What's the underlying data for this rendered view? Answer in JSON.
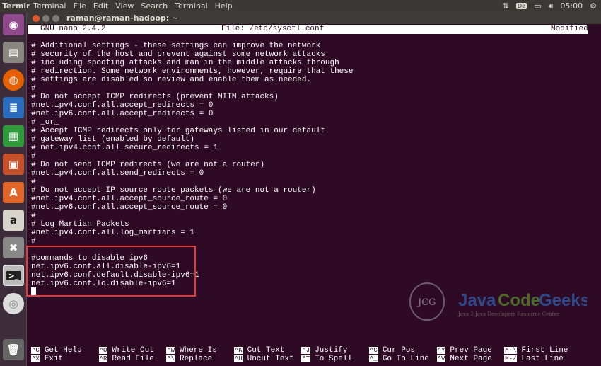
{
  "panel": {
    "app_name": "Terminal",
    "menus": [
      "Terminal",
      "File",
      "Edit",
      "View",
      "Search",
      "Terminal",
      "Help"
    ],
    "keyboard": "De",
    "clock": "05:00"
  },
  "window": {
    "title": "raman@raman-hadoop: ~"
  },
  "nano": {
    "version": "GNU nano 2.4.2",
    "file": "File: /etc/sysctl.conf",
    "status": "Modified"
  },
  "lines": [
    "# Additional settings - these settings can improve the network",
    "# security of the host and prevent against some network attacks",
    "# including spoofing attacks and man in the middle attacks through",
    "# redirection. Some network environments, however, require that these",
    "# settings are disabled so review and enable them as needed.",
    "#",
    "# Do not accept ICMP redirects (prevent MITM attacks)",
    "#net.ipv4.conf.all.accept_redirects = 0",
    "#net.ipv6.conf.all.accept_redirects = 0",
    "# _or_",
    "# Accept ICMP redirects only for gateways listed in our default",
    "# gateway list (enabled by default)",
    "# net.ipv4.conf.all.secure_redirects = 1",
    "#",
    "# Do not send ICMP redirects (we are not a router)",
    "#net.ipv4.conf.all.send_redirects = 0",
    "#",
    "# Do not accept IP source route packets (we are not a router)",
    "#net.ipv4.conf.all.accept_source_route = 0",
    "#net.ipv6.conf.all.accept_source_route = 0",
    "#",
    "# Log Martian Packets",
    "#net.ipv4.conf.all.log_martians = 1",
    "#",
    "",
    "#commands to disable ipv6",
    "net.ipv6.conf.all.disable-ipv6=1",
    "net.ipv6.conf.default.disable-ipv6=1",
    "net.ipv6.conf.lo.disable-ipv6=1"
  ],
  "shortcuts": [
    [
      {
        "key": "^G",
        "label": "Get Help"
      },
      {
        "key": "^X",
        "label": "Exit"
      }
    ],
    [
      {
        "key": "^O",
        "label": "Write Out"
      },
      {
        "key": "^R",
        "label": "Read File"
      }
    ],
    [
      {
        "key": "^W",
        "label": "Where Is"
      },
      {
        "key": "^\\",
        "label": "Replace"
      }
    ],
    [
      {
        "key": "^K",
        "label": "Cut Text"
      },
      {
        "key": "^U",
        "label": "Uncut Text"
      }
    ],
    [
      {
        "key": "^J",
        "label": "Justify"
      },
      {
        "key": "^T",
        "label": "To Spell"
      }
    ],
    [
      {
        "key": "^C",
        "label": "Cur Pos"
      },
      {
        "key": "^_",
        "label": "Go To Line"
      }
    ],
    [
      {
        "key": "^Y",
        "label": "Prev Page"
      },
      {
        "key": "^V",
        "label": "Next Page"
      }
    ],
    [
      {
        "key": "M-\\",
        "label": "First Line"
      },
      {
        "key": "M-/",
        "label": "Last Line"
      }
    ]
  ],
  "watermark": {
    "logo": "JCG",
    "name1": "Java",
    "name2": "Code",
    "name3": "Geeks",
    "tagline": "Java 2 Java Developers Resource Center"
  },
  "launcher": [
    "ubuntu-dash",
    "files",
    "firefox",
    "writer",
    "calc",
    "impress",
    "software-center",
    "amazon",
    "settings",
    "terminal",
    "dvd",
    "trash"
  ]
}
